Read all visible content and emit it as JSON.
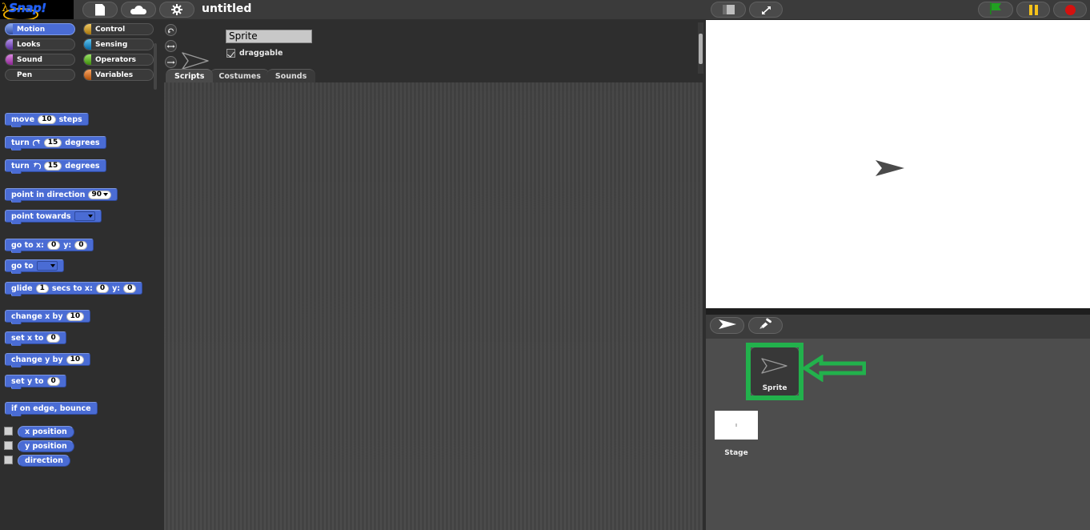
{
  "app": {
    "logo_text": "Snap!",
    "logo_lambda": "λ",
    "project_title": "untitled"
  },
  "toolbar": {
    "file_icon": "file-icon",
    "cloud_icon": "cloud-icon",
    "settings_icon": "gear-icon",
    "stage_size_icon": "stage-size-icon",
    "presentation_icon": "presentation-mode-icon",
    "green_flag_icon": "green-flag-icon",
    "pause_icon": "pause-icon",
    "stop_icon": "stop-icon",
    "green_flag_color": "#21a121",
    "pause_color": "#f5c21b",
    "stop_color": "#d4110f"
  },
  "palette": {
    "categories": [
      {
        "label": "Motion",
        "color": "#4a6cd4",
        "selected": true,
        "col": 0
      },
      {
        "label": "Control",
        "color": "#e6a822",
        "selected": false,
        "col": 1
      },
      {
        "label": "Looks",
        "color": "#8a55d7",
        "selected": false,
        "col": 0
      },
      {
        "label": "Sensing",
        "color": "#0494dc",
        "selected": false,
        "col": 1
      },
      {
        "label": "Sound",
        "color": "#bb42c3",
        "selected": false,
        "col": 0
      },
      {
        "label": "Operators",
        "color": "#62c213",
        "selected": false,
        "col": 1
      },
      {
        "label": "Pen",
        "color": "#00a178",
        "selected": false,
        "col": 0
      },
      {
        "label": "Variables",
        "color": "#f3761d",
        "selected": false,
        "col": 1
      }
    ],
    "blocks": {
      "move": {
        "pre": "move",
        "value": "10",
        "post": "steps"
      },
      "turn_right": {
        "pre": "turn",
        "icon": "turn-clockwise-icon",
        "value": "15",
        "post": "degrees"
      },
      "turn_left": {
        "pre": "turn",
        "icon": "turn-counterclockwise-icon",
        "value": "15",
        "post": "degrees"
      },
      "point_in_direction": {
        "pre": "point in direction",
        "value": "90"
      },
      "point_towards": {
        "pre": "point towards"
      },
      "go_to_xy": {
        "pre": "go to x:",
        "x": "0",
        "mid": "y:",
        "y": "0"
      },
      "go_to": {
        "pre": "go to"
      },
      "glide": {
        "pre": "glide",
        "secs": "1",
        "mid1": "secs to x:",
        "x": "0",
        "mid2": "y:",
        "y": "0"
      },
      "change_x_by": {
        "pre": "change x by",
        "value": "10"
      },
      "set_x_to": {
        "pre": "set x to",
        "value": "0"
      },
      "change_y_by": {
        "pre": "change y by",
        "value": "10"
      },
      "set_y_to": {
        "pre": "set y to",
        "value": "0"
      },
      "if_on_edge": {
        "pre": "if on edge, bounce"
      },
      "x_position": {
        "label": "x position"
      },
      "y_position": {
        "label": "y position"
      },
      "direction": {
        "label": "direction"
      }
    }
  },
  "sprite_panel": {
    "rotation_style_rotate_icon": "rotate-freely-icon",
    "rotation_style_leftright_icon": "left-right-flip-icon",
    "rotation_style_none_icon": "no-rotation-icon",
    "name_value": "Sprite",
    "draggable_label": "draggable",
    "draggable_checked": true,
    "tabs": [
      {
        "label": "Scripts",
        "active": true
      },
      {
        "label": "Costumes",
        "active": false
      },
      {
        "label": "Sounds",
        "active": false
      }
    ]
  },
  "stage": {
    "background_color": "#ffffff",
    "sprite_glyph": "arrow-turtle-icon"
  },
  "corral": {
    "add_sprite_icon": "add-sprite-icon",
    "paint_new_sprite_icon": "paintbrush-icon",
    "sprites": [
      {
        "name": "Sprite",
        "selected": true
      }
    ],
    "stage_label": "Stage",
    "highlight_color": "#22b14c",
    "annotation_arrow": "left-pointing-arrow-annotation"
  }
}
